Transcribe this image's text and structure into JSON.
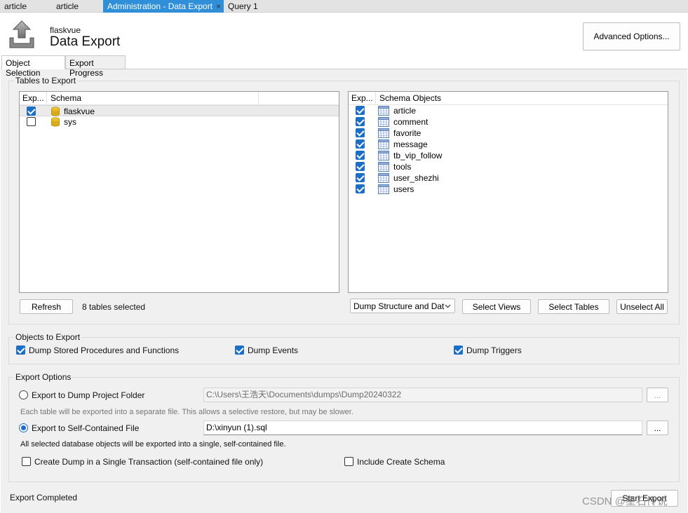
{
  "tabs": [
    {
      "label": "article"
    },
    {
      "label": "article"
    },
    {
      "label": "Administration - Data Export",
      "close": "×"
    },
    {
      "label": "Query 1"
    }
  ],
  "header": {
    "schema": "flaskvue",
    "title": "Data Export",
    "advanced_label": "Advanced Options..."
  },
  "subtabs": [
    {
      "label": "Object Selection"
    },
    {
      "label": "Export Progress"
    }
  ],
  "tables_to_export": {
    "title": "Tables to Export",
    "left": {
      "col_export": "Exp...",
      "col_schema": "Schema",
      "rows": [
        {
          "name": "flaskvue",
          "checked": true
        },
        {
          "name": "sys",
          "checked": false
        }
      ]
    },
    "right": {
      "col_export": "Exp...",
      "col_objects": "Schema Objects",
      "rows": [
        {
          "name": "article",
          "checked": true
        },
        {
          "name": "comment",
          "checked": true
        },
        {
          "name": "favorite",
          "checked": true
        },
        {
          "name": "message",
          "checked": true
        },
        {
          "name": "tb_vip_follow",
          "checked": true
        },
        {
          "name": "tools",
          "checked": true
        },
        {
          "name": "user_shezhi",
          "checked": true
        },
        {
          "name": "users",
          "checked": true
        }
      ]
    },
    "refresh_label": "Refresh",
    "selected_count": "8 tables selected",
    "dump_mode": "Dump Structure and Dat",
    "select_views_label": "Select Views",
    "select_tables_label": "Select Tables",
    "unselect_all_label": "Unselect All"
  },
  "objects_to_export": {
    "title": "Objects to Export",
    "stored_procs": "Dump Stored Procedures and Functions",
    "events": "Dump Events",
    "triggers": "Dump Triggers"
  },
  "export_options": {
    "title": "Export Options",
    "folder_label": "Export to Dump Project Folder",
    "folder_path": "C:\\Users\\王浩天\\Documents\\dumps\\Dump20240322",
    "folder_hint": "Each table will be exported into a separate file. This allows a selective restore, but may be slower.",
    "file_label": "Export to Self-Contained File",
    "file_path": "D:\\xinyun (1).sql",
    "file_hint": "All selected database objects will be exported into a single, self-contained file.",
    "browse_label": "...",
    "single_transaction": "Create Dump in a Single Transaction (self-contained file only)",
    "include_schema": "Include Create Schema"
  },
  "footer": {
    "status": "Export Completed",
    "start_label": "Start Export",
    "watermark": "CSDN @星石传说"
  },
  "colors": {
    "accent": "#2f8fd8",
    "checkbox": "#1c6fc7",
    "panel": "#f0f0f0"
  }
}
